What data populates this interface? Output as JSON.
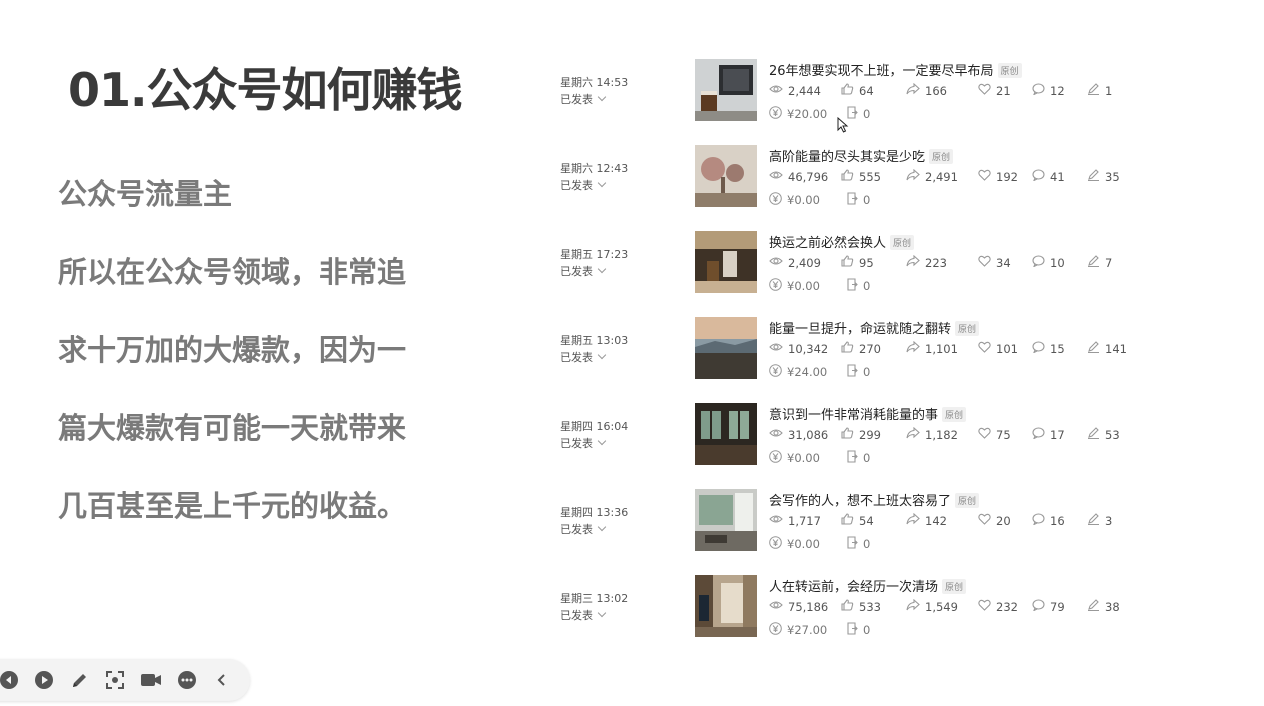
{
  "slide": {
    "title": "01.公众号如何赚钱",
    "lines": [
      "公众号流量主",
      "所以在公众号领域，非常追",
      "求十万加的大爆款，因为一",
      "篇大爆款有可能一天就带来",
      "几百甚至是上千元的收益。"
    ]
  },
  "articles": [
    {
      "time": "星期六 14:53",
      "status": "已发表",
      "title": "26年想要实现不上班，一定要尽早布局",
      "badge": "原创",
      "views": "2,444",
      "likes": "64",
      "shares": "166",
      "favorites": "21",
      "comments": "12",
      "edits": "1",
      "income": "¥20.00",
      "ads": "0"
    },
    {
      "time": "星期六 12:43",
      "status": "已发表",
      "title": "高阶能量的尽头其实是少吃",
      "badge": "原创",
      "views": "46,796",
      "likes": "555",
      "shares": "2,491",
      "favorites": "192",
      "comments": "41",
      "edits": "35",
      "income": "¥0.00",
      "ads": "0"
    },
    {
      "time": "星期五 17:23",
      "status": "已发表",
      "title": "换运之前必然会换人",
      "badge": "原创",
      "views": "2,409",
      "likes": "95",
      "shares": "223",
      "favorites": "34",
      "comments": "10",
      "edits": "7",
      "income": "¥0.00",
      "ads": "0"
    },
    {
      "time": "星期五 13:03",
      "status": "已发表",
      "title": "能量一旦提升，命运就随之翻转",
      "badge": "原创",
      "views": "10,342",
      "likes": "270",
      "shares": "1,101",
      "favorites": "101",
      "comments": "15",
      "edits": "141",
      "income": "¥24.00",
      "ads": "0"
    },
    {
      "time": "星期四 16:04",
      "status": "已发表",
      "title": "意识到一件非常消耗能量的事",
      "badge": "原创",
      "views": "31,086",
      "likes": "299",
      "shares": "1,182",
      "favorites": "75",
      "comments": "17",
      "edits": "53",
      "income": "¥0.00",
      "ads": "0"
    },
    {
      "time": "星期四 13:36",
      "status": "已发表",
      "title": "会写作的人，想不上班太容易了",
      "badge": "原创",
      "views": "1,717",
      "likes": "54",
      "shares": "142",
      "favorites": "20",
      "comments": "16",
      "edits": "3",
      "income": "¥0.00",
      "ads": "0"
    },
    {
      "time": "星期三 13:02",
      "status": "已发表",
      "title": "人在转运前，会经历一次清场",
      "badge": "原创",
      "views": "75,186",
      "likes": "533",
      "shares": "1,549",
      "favorites": "232",
      "comments": "79",
      "edits": "38",
      "income": "¥27.00",
      "ads": "0"
    }
  ],
  "toolbar": {
    "icons": [
      "prev-icon",
      "play-icon",
      "pen-icon",
      "screenshot-icon",
      "camera-icon",
      "more-icon",
      "collapse-icon"
    ]
  }
}
